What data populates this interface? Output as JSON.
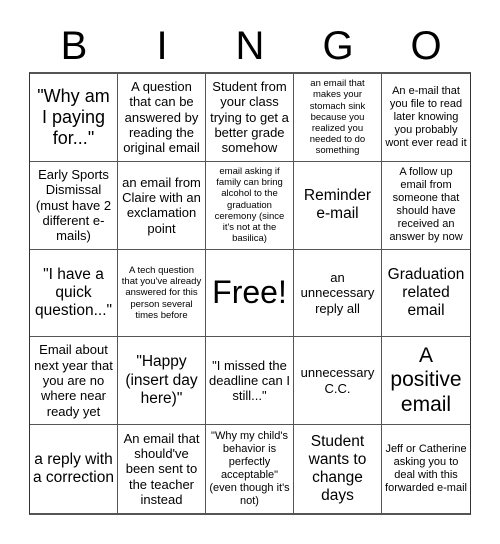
{
  "header": {
    "letters": [
      "B",
      "I",
      "N",
      "G",
      "O"
    ]
  },
  "grid": {
    "rows": [
      [
        "\"Why am I paying for...\"",
        "A question that can be answered by reading the original email",
        "Student from your class trying to get a better grade somehow",
        "an email that makes your stomach sink because you realized you needed to do something",
        "An e-mail that you file to read later knowing you probably wont ever read it"
      ],
      [
        "Early Sports Dismissal (must have 2 different e-mails)",
        "an email from Claire with an exclamation point",
        "email asking if family can bring alcohol to the graduation ceremony (since it's not at the basilica)",
        "Reminder e-mail",
        "A follow up email from someone that should have received an answer by now"
      ],
      [
        "\"I have a quick question...\"",
        "A tech question that you've already answered for this person several times before",
        "Free!",
        "an unnecessary reply all",
        "Graduation related email"
      ],
      [
        "Email about next year that you are no where near ready yet",
        "\"Happy (insert day here)\"",
        "\"I missed the deadline can I still...\"",
        "unnecessary C.C.",
        "A positive email"
      ],
      [
        "a reply with a correction",
        "An email that should've been sent to the teacher instead",
        "\"Why my child's behavior is perfectly acceptable\" (even though it's not)",
        "Student wants to change days",
        "Jeff or Catherine asking you to deal with this forwarded e-mail"
      ]
    ]
  }
}
